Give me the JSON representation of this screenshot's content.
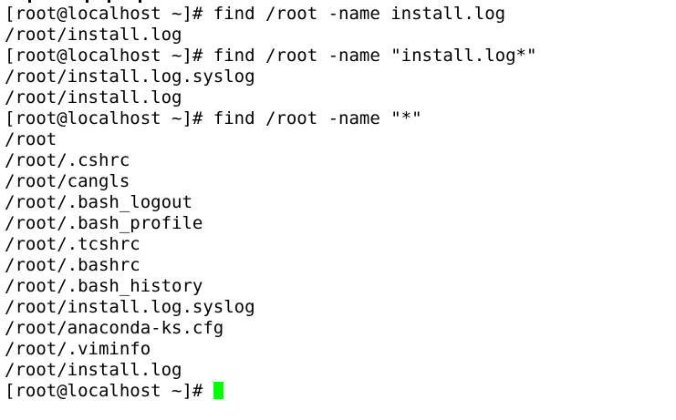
{
  "terminal": {
    "background": "#ffffff",
    "foreground": "#000000",
    "cursor_color": "#00ff00",
    "lines": [
      "[root@localhost ~]# find /root -name install.log",
      "/root/install.log",
      "[root@localhost ~]# find /root -name \"install.log*\"",
      "/root/install.log.syslog",
      "/root/install.log",
      "[root@localhost ~]# find /root -name \"*\"",
      "/root",
      "/root/.cshrc",
      "/root/cangls",
      "/root/.bash_logout",
      "/root/.bash_profile",
      "/root/.tcshrc",
      "/root/.bashrc",
      "/root/.bash_history",
      "/root/install.log.syslog",
      "/root/anaconda-ks.cfg",
      "/root/.viminfo",
      "/root/install.log"
    ],
    "current_prompt": "[root@localhost ~]# "
  }
}
